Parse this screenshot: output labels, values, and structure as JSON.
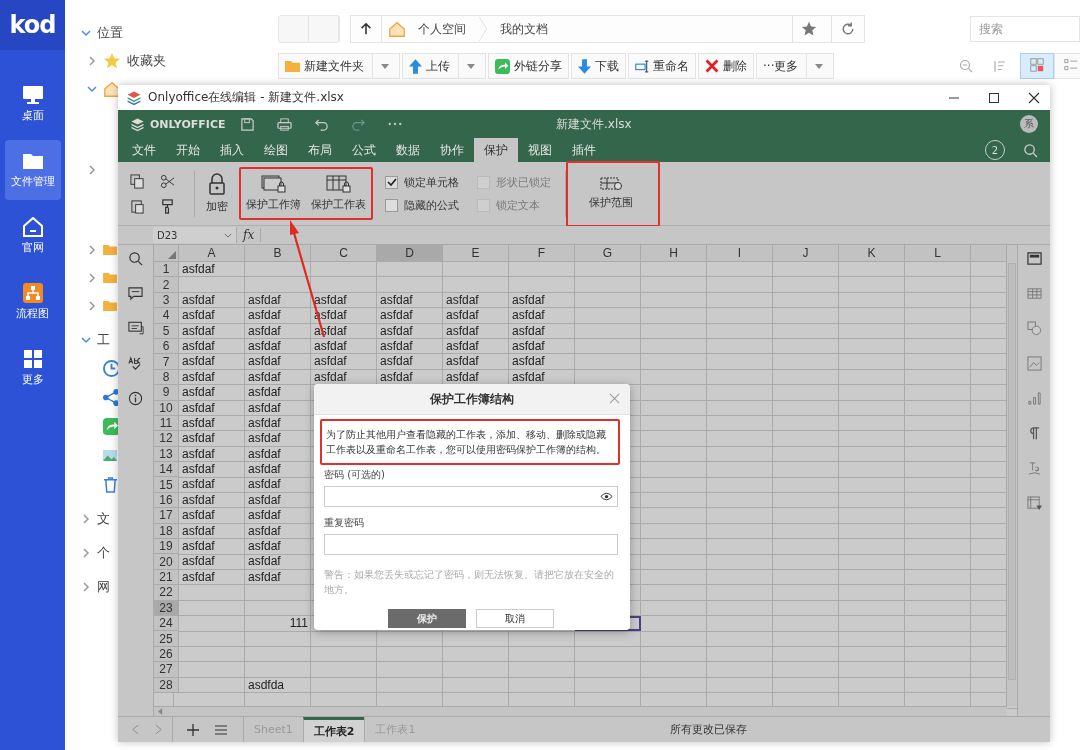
{
  "app": {
    "logo": "kod",
    "nav": [
      {
        "label": "桌面",
        "selected": false
      },
      {
        "label": "文件管理",
        "selected": true
      },
      {
        "label": "官网",
        "selected": false
      },
      {
        "label": "流程图",
        "selected": false
      },
      {
        "label": "更多",
        "selected": false
      }
    ]
  },
  "tree": [
    {
      "label": "位置",
      "expanded": true,
      "children": [
        {
          "kind": "favorites",
          "label": "收藏夹",
          "expanded": false
        },
        {
          "kind": "home",
          "expanded": true
        },
        {
          "kind": "blank",
          "expanded": false
        },
        {
          "kind": "folder",
          "expanded": false
        },
        {
          "kind": "folder",
          "expanded": false
        },
        {
          "kind": "folder",
          "expanded": false
        }
      ]
    },
    {
      "label": "工",
      "expanded": true,
      "children": [
        {
          "kind": "recent"
        },
        {
          "kind": "shared"
        },
        {
          "kind": "link"
        },
        {
          "kind": "photo"
        },
        {
          "kind": "trash"
        }
      ]
    },
    {
      "label": "文",
      "expanded": false
    },
    {
      "label": "个",
      "expanded": false
    },
    {
      "label": "网",
      "expanded": false
    }
  ],
  "path": {
    "crumbs": [
      "个人空间",
      "我的文档"
    ]
  },
  "search": {
    "placeholder": "搜索"
  },
  "actions": [
    {
      "label": "新建文件夹",
      "dropdown": true
    },
    {
      "label": "上传",
      "dropdown": true
    },
    {
      "label": "外链分享",
      "dropdown": false
    },
    {
      "label": "下载",
      "dropdown": false
    },
    {
      "label": "重命名",
      "dropdown": false
    },
    {
      "label": "删除",
      "dropdown": false
    },
    {
      "label": "···更多",
      "dropdown": true
    }
  ],
  "view_modes": [
    {
      "selected": true
    },
    {
      "selected": false
    }
  ],
  "editor": {
    "window_title": "Onlyoffice在线编辑 - 新建文件.xlsx",
    "brand": "ONLYOFFICE",
    "file_name": "新建文件.xlsx",
    "avatar": "系",
    "user_count": "2",
    "tabs": [
      {
        "label": "文件",
        "selected": false
      },
      {
        "label": "开始",
        "selected": false
      },
      {
        "label": "插入",
        "selected": false
      },
      {
        "label": "绘图",
        "selected": false
      },
      {
        "label": "布局",
        "selected": false
      },
      {
        "label": "公式",
        "selected": false
      },
      {
        "label": "数据",
        "selected": false
      },
      {
        "label": "协作",
        "selected": false
      },
      {
        "label": "保护",
        "selected": true
      },
      {
        "label": "视图",
        "selected": false
      },
      {
        "label": "插件",
        "selected": false
      }
    ],
    "ribbon": {
      "encrypt": "加密",
      "protect_buttons": [
        "保护工作簿",
        "保护工作表"
      ],
      "options": [
        {
          "label": "锁定单元格",
          "checked": true,
          "disabled": false
        },
        {
          "label": "形状已锁定",
          "checked": false,
          "disabled": true
        },
        {
          "label": "隐藏的公式",
          "checked": false,
          "disabled": false
        },
        {
          "label": "锁定文本",
          "checked": false,
          "disabled": true
        }
      ],
      "range_button": "保护范围"
    },
    "name_box": "D23",
    "fx": "fx",
    "columns": [
      {
        "label": "A",
        "selected": false,
        "outlined": false
      },
      {
        "label": "B",
        "selected": false,
        "outlined": false
      },
      {
        "label": "C",
        "selected": false,
        "outlined": false
      },
      {
        "label": "D",
        "selected": true,
        "outlined": false
      },
      {
        "label": "E",
        "selected": false,
        "outlined": false
      },
      {
        "label": "F",
        "selected": false,
        "outlined": false
      },
      {
        "label": "G",
        "selected": false,
        "outlined": true
      },
      {
        "label": "H",
        "selected": false,
        "outlined": false
      },
      {
        "label": "I",
        "selected": false,
        "outlined": false
      },
      {
        "label": "J",
        "selected": false,
        "outlined": false
      },
      {
        "label": "K",
        "selected": false,
        "outlined": false
      },
      {
        "label": "L",
        "selected": false,
        "outlined": false
      }
    ],
    "rows": [
      {
        "label": "1",
        "selected": false,
        "outlined": false,
        "cells": [
          "asfdaf"
        ]
      },
      {
        "label": "2",
        "selected": false,
        "outlined": false
      },
      {
        "label": "3",
        "selected": false,
        "outlined": false,
        "cells": [
          "asfdaf",
          "asfdaf",
          "asfdaf",
          "asfdaf",
          "asfdaf",
          "asfdaf"
        ]
      },
      {
        "label": "4",
        "selected": false,
        "outlined": false,
        "cells": [
          "asfdaf",
          "asfdaf",
          "asfdaf",
          "asfdaf",
          "asfdaf",
          "asfdaf"
        ]
      },
      {
        "label": "5",
        "selected": false,
        "outlined": false,
        "cells": [
          "asfdaf",
          "asfdaf",
          "asfdaf",
          "asfdaf",
          "asfdaf",
          "asfdaf"
        ]
      },
      {
        "label": "6",
        "selected": false,
        "outlined": false,
        "cells": [
          "asfdaf",
          "asfdaf",
          "asfdaf",
          "asfdaf",
          "asfdaf",
          "asfdaf"
        ]
      },
      {
        "label": "7",
        "selected": false,
        "outlined": false,
        "cells": [
          "asfdaf",
          "asfdaf",
          "asfdaf",
          "asfdaf",
          "asfdaf",
          "asfdaf"
        ]
      },
      {
        "label": "8",
        "selected": false,
        "outlined": false,
        "cells": [
          "asfdaf",
          "asfdaf",
          "asfdaf",
          "asfdaf",
          "asfdaf",
          "asfdaf"
        ]
      },
      {
        "label": "9",
        "selected": false,
        "outlined": false,
        "cells": [
          "asfdaf",
          "asfdaf"
        ]
      },
      {
        "label": "10",
        "selected": false,
        "outlined": false,
        "cells": [
          "asfdaf",
          "asfdaf"
        ]
      },
      {
        "label": "11",
        "selected": false,
        "outlined": false,
        "cells": [
          "asfdaf",
          "asfdaf"
        ]
      },
      {
        "label": "12",
        "selected": false,
        "outlined": false,
        "cells": [
          "asfdaf",
          "asfdaf"
        ]
      },
      {
        "label": "13",
        "selected": false,
        "outlined": false,
        "cells": [
          "asfdaf",
          "asfdaf"
        ]
      },
      {
        "label": "14",
        "selected": false,
        "outlined": false,
        "cells": [
          "asfdaf",
          "asfdaf"
        ]
      },
      {
        "label": "15",
        "selected": false,
        "outlined": false,
        "cells": [
          "asfdaf",
          "asfdaf"
        ]
      },
      {
        "label": "16",
        "selected": false,
        "outlined": false,
        "cells": [
          "asfdaf",
          "asfdaf"
        ]
      },
      {
        "label": "17",
        "selected": false,
        "outlined": false,
        "cells": [
          "asfdaf",
          "asfdaf"
        ]
      },
      {
        "label": "18",
        "selected": false,
        "outlined": false,
        "cells": [
          "asfdaf",
          "asfdaf"
        ]
      },
      {
        "label": "19",
        "selected": false,
        "outlined": false,
        "cells": [
          "asfdaf",
          "asfdaf"
        ]
      },
      {
        "label": "20",
        "selected": false,
        "outlined": false,
        "cells": [
          "asfdaf",
          "asfdaf"
        ]
      },
      {
        "label": "21",
        "selected": false,
        "outlined": false,
        "cells": [
          "asfdaf",
          "asfdaf"
        ]
      },
      {
        "label": "22",
        "selected": false,
        "outlined": false
      },
      {
        "label": "23",
        "selected": true,
        "outlined": false
      },
      {
        "label": "24",
        "selected": false,
        "outlined": true,
        "cells": [
          null,
          "111"
        ]
      },
      {
        "label": "25",
        "selected": false,
        "outlined": false
      },
      {
        "label": "26",
        "selected": false,
        "outlined": false
      },
      {
        "label": "27",
        "selected": false,
        "outlined": false
      },
      {
        "label": "28",
        "selected": false,
        "outlined": false,
        "cells": [
          null,
          "asdfda"
        ]
      }
    ],
    "sheets": [
      {
        "label": "Sheet1",
        "selected": false
      },
      {
        "label": "工作表2",
        "selected": true
      },
      {
        "label": "工作表1",
        "selected": false
      }
    ],
    "status": "所有更改已保存",
    "dialog": {
      "title": "保护工作簿结构",
      "description": "为了防止其他用户查看隐藏的工作表，添加、移动、删除或隐藏工作表以及重命名工作表，您可以使用密码保护工作簿的结构。",
      "password_label": "密码 (可选的)",
      "repeat_label": "重复密码",
      "warning": "警告：如果您丢失或忘记了密码，则无法恢复。请把它放在安全的地方。",
      "buttons": [
        {
          "label": "保护",
          "primary": true
        },
        {
          "label": "取消",
          "primary": false
        }
      ]
    }
  }
}
